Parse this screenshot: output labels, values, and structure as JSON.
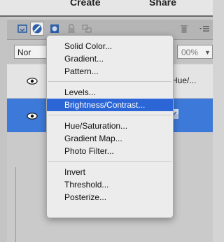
{
  "header": {
    "tab_create": "Create",
    "tab_share": "Share"
  },
  "layers_panel": {
    "blend_mode": "Nor",
    "opacity": "00%",
    "layers": [
      {
        "name": "Hue/...",
        "visible": true,
        "selected": false
      },
      {
        "name": "",
        "visible": true,
        "selected": true
      }
    ]
  },
  "toolbar": {
    "icons": [
      "new-layer-icon",
      "adjustment-layer-icon",
      "layer-mask-icon",
      "lock-icon",
      "link-icon",
      "trash-icon",
      "panel-menu-icon"
    ]
  },
  "adjustment_menu": {
    "groups": [
      [
        "Solid Color...",
        "Gradient...",
        "Pattern..."
      ],
      [
        "Levels...",
        "Brightness/Contrast..."
      ],
      [
        "Hue/Saturation...",
        "Gradient Map...",
        "Photo Filter..."
      ],
      [
        "Invert",
        "Threshold...",
        "Posterize..."
      ]
    ],
    "highlighted": "Brightness/Contrast..."
  },
  "colors": {
    "accent": "#2c66d6",
    "selected_layer": "#3d79d8"
  }
}
